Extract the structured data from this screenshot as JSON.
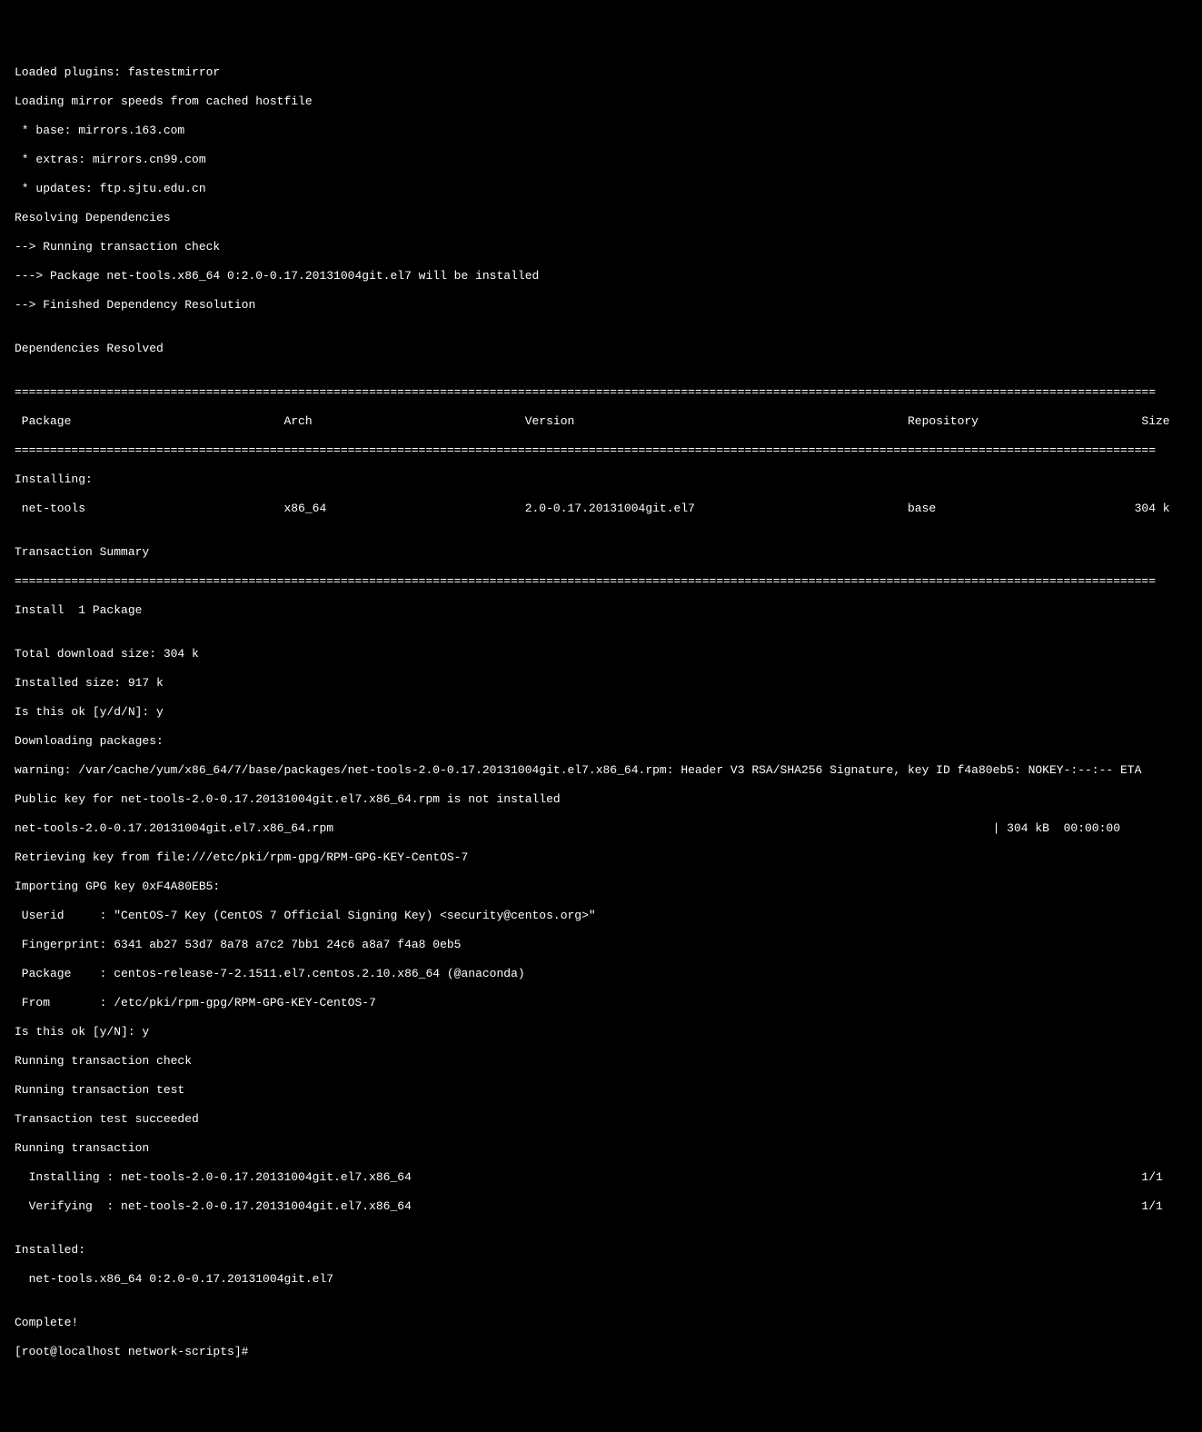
{
  "lines": {
    "l1": "Loaded plugins: fastestmirror",
    "l2": "Loading mirror speeds from cached hostfile",
    "l3": " * base: mirrors.163.com",
    "l4": " * extras: mirrors.cn99.com",
    "l5": " * updates: ftp.sjtu.edu.cn",
    "l6": "Resolving Dependencies",
    "l7": "--> Running transaction check",
    "l8": "---> Package net-tools.x86_64 0:2.0-0.17.20131004git.el7 will be installed",
    "l9": "--> Finished Dependency Resolution",
    "l10": "",
    "l11": "Dependencies Resolved",
    "l12": "",
    "divider": "=================================================================================================================================================================",
    "header": " Package                              Arch                              Version                                               Repository                       Size",
    "l13": "Installing:",
    "row1": " net-tools                            x86_64                            2.0-0.17.20131004git.el7                              base                            304 k",
    "l14": "",
    "l15": "Transaction Summary",
    "l16": "Install  1 Package",
    "l17": "",
    "l18": "Total download size: 304 k",
    "l19": "Installed size: 917 k",
    "l20": "Is this ok [y/d/N]: y",
    "l21": "Downloading packages:",
    "l22": "warning: /var/cache/yum/x86_64/7/base/packages/net-tools-2.0-0.17.20131004git.el7.x86_64.rpm: Header V3 RSA/SHA256 Signature, key ID f4a80eb5: NOKEY-:--:-- ETA",
    "l23": "Public key for net-tools-2.0-0.17.20131004git.el7.x86_64.rpm is not installed",
    "l24": "net-tools-2.0-0.17.20131004git.el7.x86_64.rpm                                                                                             | 304 kB  00:00:00",
    "l25": "Retrieving key from file:///etc/pki/rpm-gpg/RPM-GPG-KEY-CentOS-7",
    "l26": "Importing GPG key 0xF4A80EB5:",
    "l27": " Userid     : \"CentOS-7 Key (CentOS 7 Official Signing Key) <security@centos.org>\"",
    "l28": " Fingerprint: 6341 ab27 53d7 8a78 a7c2 7bb1 24c6 a8a7 f4a8 0eb5",
    "l29": " Package    : centos-release-7-2.1511.el7.centos.2.10.x86_64 (@anaconda)",
    "l30": " From       : /etc/pki/rpm-gpg/RPM-GPG-KEY-CentOS-7",
    "l31": "Is this ok [y/N]: y",
    "l32": "Running transaction check",
    "l33": "Running transaction test",
    "l34": "Transaction test succeeded",
    "l35": "Running transaction",
    "l36": "  Installing : net-tools-2.0-0.17.20131004git.el7.x86_64                                                                                                       1/1",
    "l37": "  Verifying  : net-tools-2.0-0.17.20131004git.el7.x86_64                                                                                                       1/1",
    "l38": "",
    "l39": "Installed:",
    "l40": "  net-tools.x86_64 0:2.0-0.17.20131004git.el7",
    "l41": "",
    "l42": "Complete!",
    "prompt": "[root@localhost network-scripts]# "
  }
}
